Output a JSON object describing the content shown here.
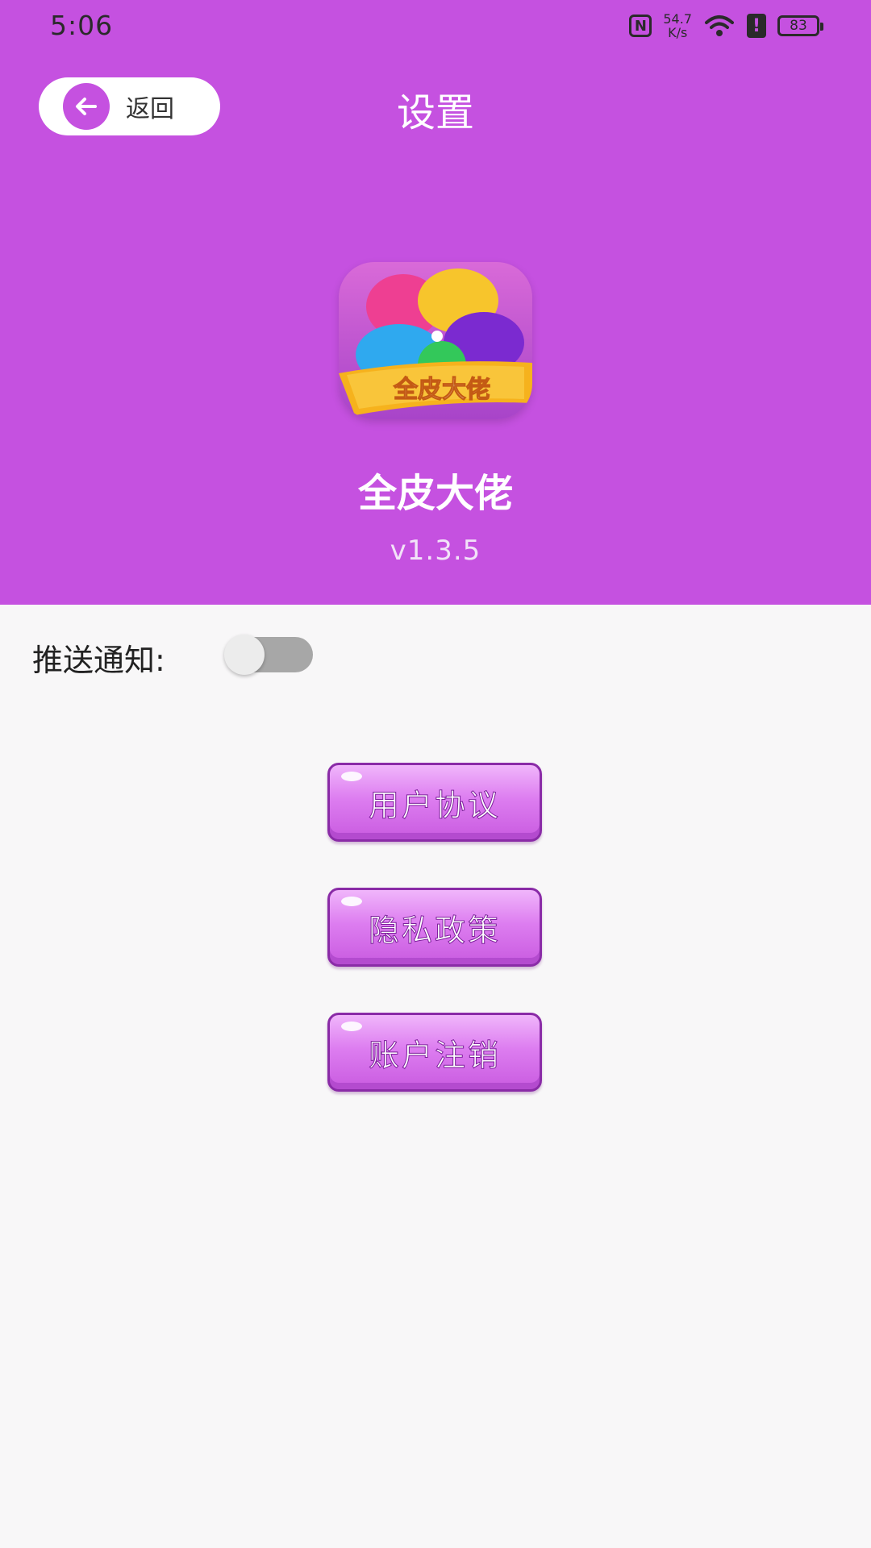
{
  "status_bar": {
    "time": "5:06",
    "nfc": "N",
    "net_speed_value": "54.7",
    "net_speed_unit": "K/s",
    "alert": "!",
    "battery": "83"
  },
  "header": {
    "back_label": "返回",
    "title": "设置"
  },
  "app": {
    "icon_text": "全皮大佬",
    "name": "全皮大佬",
    "version": "v1.3.5"
  },
  "settings": {
    "push_label": "推送通知:",
    "push_enabled": false
  },
  "menu": {
    "user_agreement": "用户协议",
    "privacy_policy": "隐私政策",
    "account_cancel": "账户注销"
  },
  "colors": {
    "header_bg": "#c551e0",
    "page_bg": "#f8f7f8",
    "button_border": "#8a2ba7"
  }
}
